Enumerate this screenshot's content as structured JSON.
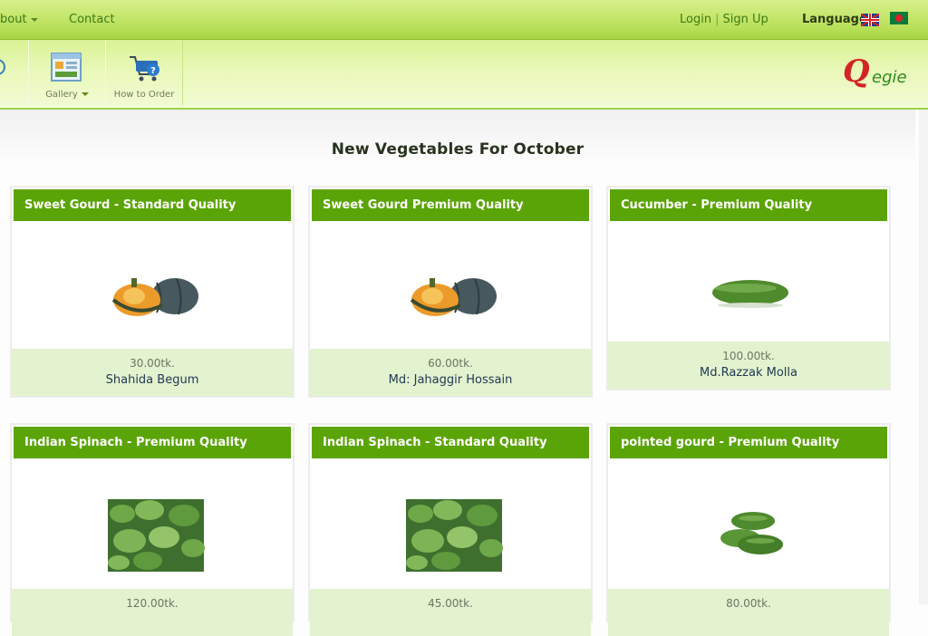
{
  "nav": {
    "about": "bout",
    "contact": "Contact",
    "login": "Login",
    "signup": "Sign Up",
    "separator": "|",
    "language": "Language"
  },
  "toolbar": {
    "gallery": "Gallery",
    "how_to_order": "How to Order",
    "logo_q": "Q",
    "logo_text": "egie"
  },
  "page_title": "New Vegetables For October",
  "products": [
    {
      "name": "Sweet Gourd - Standard Quality",
      "price": "30.00tk.",
      "seller": "Shahida Begum",
      "icon": "pumpkin"
    },
    {
      "name": "Sweet Gourd Premium Quality",
      "price": "60.00tk.",
      "seller": "Md: Jahaggir Hossain",
      "icon": "pumpkin"
    },
    {
      "name": "Cucumber - Premium Quality",
      "price": "100.00tk.",
      "seller": "Md.Razzak Molla",
      "icon": "cucumber"
    },
    {
      "name": "Indian Spinach - Premium Quality",
      "price": "120.00tk.",
      "seller": "",
      "icon": "spinach"
    },
    {
      "name": "Indian Spinach - Standard Quality",
      "price": "45.00tk.",
      "seller": "",
      "icon": "spinach"
    },
    {
      "name": "pointed gourd - Premium Quality",
      "price": "80.00tk.",
      "seller": "",
      "icon": "pointed-gourd"
    }
  ],
  "colors": {
    "card_header": "#5ba407",
    "card_footer": "#e3f2cf",
    "nav_bar": "#b9e05a"
  }
}
